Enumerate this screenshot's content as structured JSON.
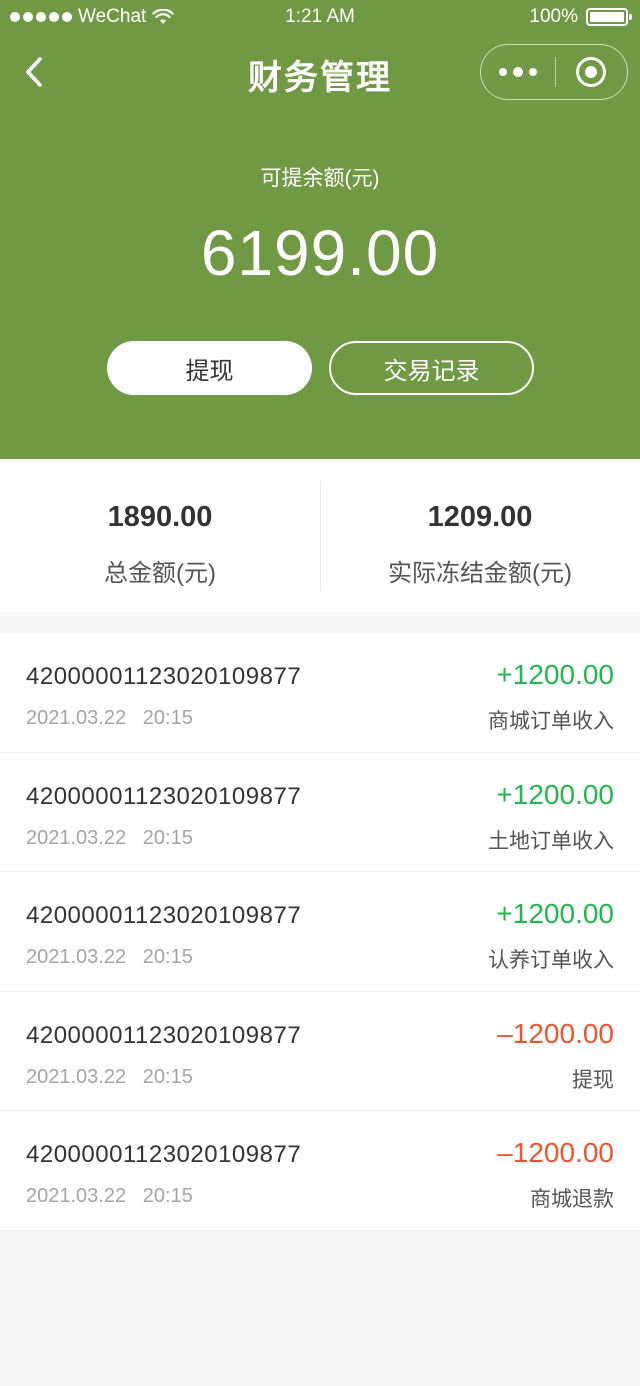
{
  "status_bar": {
    "carrier": "WeChat",
    "time": "1:21 AM",
    "battery": "100%"
  },
  "nav": {
    "title": "财务管理"
  },
  "balance": {
    "label": "可提余额(元)",
    "value": "6199.00"
  },
  "actions": {
    "withdraw_label": "提现",
    "records_label": "交易记录"
  },
  "summary": {
    "total_value": "1890.00",
    "total_label": "总金额(元)",
    "frozen_value": "1209.00",
    "frozen_label": "实际冻结金额(元)"
  },
  "transactions": [
    {
      "id": "4200000112302010987​7",
      "date": "2021.03.22",
      "time": "20:15",
      "amount": "+1200.00",
      "type": "商城订单收入",
      "direction": "income"
    },
    {
      "id": "42000001123020109877",
      "date": "2021.03.22",
      "time": "20:15",
      "amount": "+1200.00",
      "type": "土地订单收入",
      "direction": "income"
    },
    {
      "id": "42000001123020109877",
      "date": "2021.03.22",
      "time": "20:15",
      "amount": "+1200.00",
      "type": "认养订单收入",
      "direction": "income"
    },
    {
      "id": "42000001123020109877",
      "date": "2021.03.22",
      "time": "20:15",
      "amount": "–1200.00",
      "type": "提现",
      "direction": "expense"
    },
    {
      "id": "42000001123020109877",
      "date": "2021.03.22",
      "time": "20:15",
      "amount": "–1200.00",
      "type": "商城退款",
      "direction": "expense"
    }
  ],
  "colors": {
    "header_green": "#6f9a43",
    "income": "#21b94b",
    "expense": "#ee5430"
  },
  "icons": {
    "back": "chevron-left-icon",
    "more": "more-dots-icon",
    "close": "target-icon",
    "wifi": "wifi-icon",
    "battery": "battery-icon"
  }
}
